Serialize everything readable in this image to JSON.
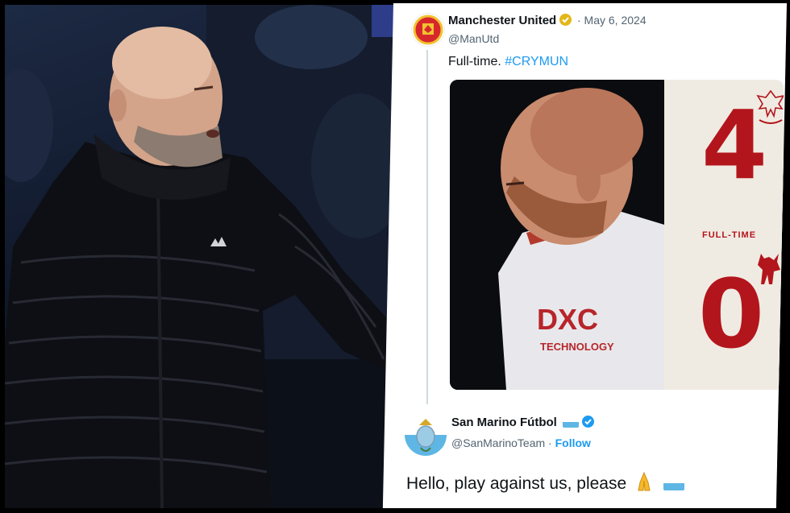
{
  "colors": {
    "twitter_blue": "#1d9bf0",
    "text": "#0f1419",
    "muted": "#536471",
    "united_red": "#b3151c",
    "gold_check": "#e2b719"
  },
  "left_photo": {
    "subject": "manager-in-black-puffer-jacket"
  },
  "tweet": {
    "author_name": "Manchester United",
    "verified_icon": "gold-verified-badge",
    "date": "· May 6, 2024",
    "handle": "@ManUtd",
    "text_prefix": "Full-time.",
    "hashtag": "#CRYMUN",
    "media": {
      "home_score": "4",
      "away_score": "0",
      "status_label": "FULL-TIME",
      "home_crest_icon": "crystal-palace-eagle-crest",
      "away_crest_icon": "man-utd-devil-crest",
      "shirt_sponsor": "TECHNOLOGY"
    }
  },
  "reply": {
    "author_name": "San Marino Fútbol",
    "handle": "@SanMarinoTeam",
    "separator": "·",
    "follow_label": "Follow",
    "text": "Hello, play against us, please",
    "emoji_icons": [
      "praying-hands-icon",
      "san-marino-flag-icon"
    ]
  }
}
